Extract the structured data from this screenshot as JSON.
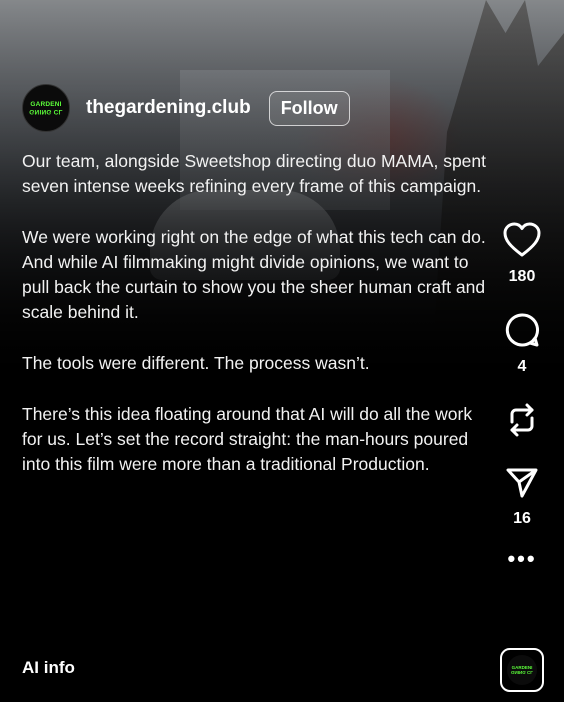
{
  "post": {
    "username": "thegardening.club",
    "follow_label": "Follow",
    "avatar_text": [
      "GARDENI",
      "GNING CL"
    ],
    "caption": [
      "Our team, alongside Sweetshop directing duo MAMA, spent seven intense weeks refining every frame of this campaign.",
      "We were working right on the edge of what this tech can do. And while AI filmmaking might divide opinions, we want to pull back the curtain to show you the sheer human craft and scale behind it.",
      "The tools were different. The process wasn’t.",
      "There’s this idea floating around that AI will do all the work for us. Let’s set the record straight: the man-hours poured into this film were more than a traditional Production."
    ]
  },
  "actions": {
    "likes": "180",
    "comments": "4",
    "shares": "16",
    "more": "•••",
    "icons": [
      "heart-icon",
      "comment-icon",
      "repost-icon",
      "send-icon",
      "more-icon"
    ]
  },
  "footer": {
    "ai_info": "AI info"
  },
  "colors": {
    "background": "#000000",
    "text": "#ffffff",
    "brand_green": "#5cff3a"
  }
}
